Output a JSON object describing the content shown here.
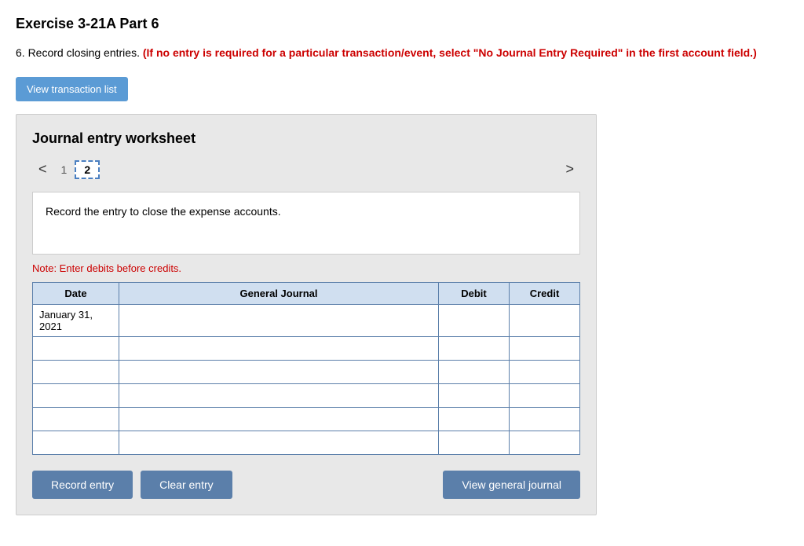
{
  "page": {
    "title": "Exercise 3-21A Part 6",
    "instructions_prefix": "6. Record closing entries. ",
    "instructions_bold": "(If no entry is required for a particular transaction/event, select \"No Journal Entry Required\" in the first account field.)",
    "view_transaction_btn": "View transaction list"
  },
  "worksheet": {
    "title": "Journal entry worksheet",
    "nav": {
      "left_arrow": "<",
      "right_arrow": ">",
      "pages": [
        {
          "label": "1",
          "active": false
        },
        {
          "label": "2",
          "active": true
        }
      ]
    },
    "description": "Record the entry to close the expense accounts.",
    "note": "Note: Enter debits before credits.",
    "table": {
      "headers": [
        "Date",
        "General Journal",
        "Debit",
        "Credit"
      ],
      "rows": [
        {
          "date": "January 31, 2021",
          "account": "",
          "debit": "",
          "credit": ""
        },
        {
          "date": "",
          "account": "",
          "debit": "",
          "credit": ""
        },
        {
          "date": "",
          "account": "",
          "debit": "",
          "credit": ""
        },
        {
          "date": "",
          "account": "",
          "debit": "",
          "credit": ""
        },
        {
          "date": "",
          "account": "",
          "debit": "",
          "credit": ""
        },
        {
          "date": "",
          "account": "",
          "debit": "",
          "credit": ""
        }
      ]
    },
    "buttons": {
      "record": "Record entry",
      "clear": "Clear entry",
      "view_journal": "View general journal"
    }
  }
}
